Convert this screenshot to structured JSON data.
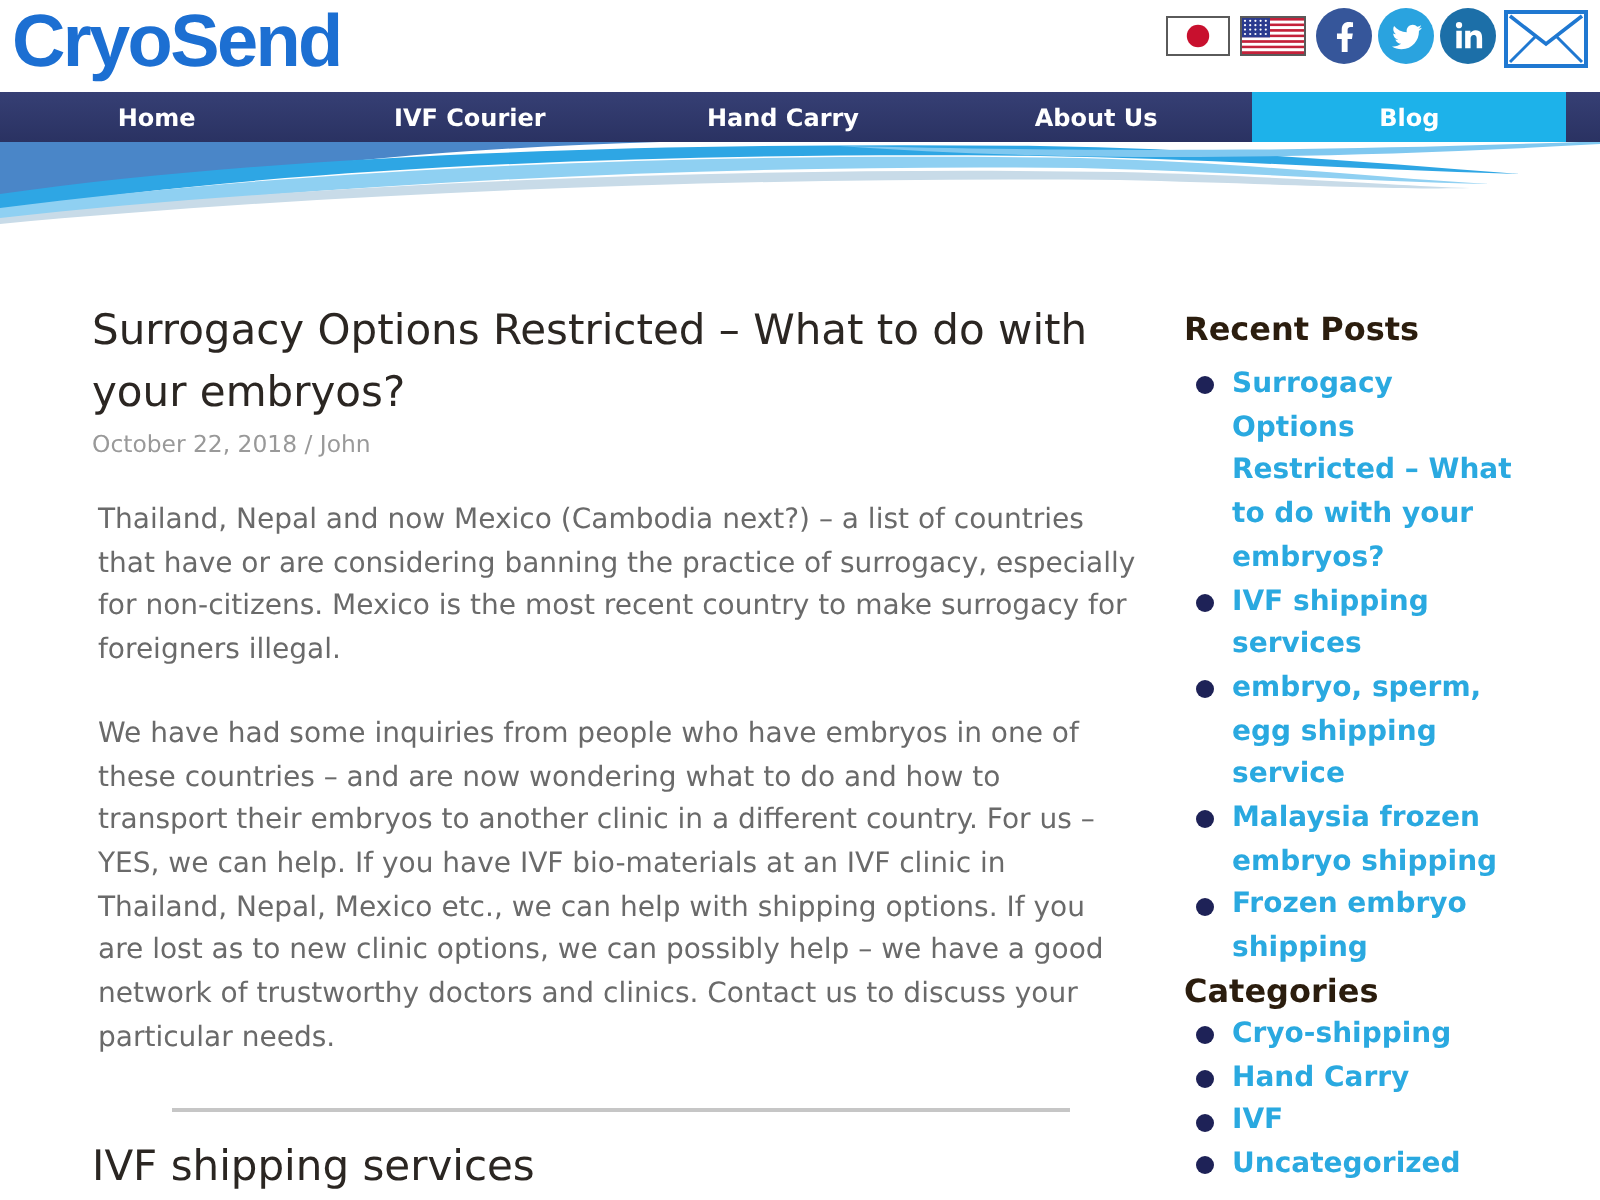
{
  "logo": {
    "text": "CryoSend"
  },
  "nav": [
    {
      "label": "Home",
      "selected": false
    },
    {
      "label": "IVF Courier",
      "selected": false
    },
    {
      "label": "Hand Carry",
      "selected": false
    },
    {
      "label": "About Us",
      "selected": false
    },
    {
      "label": "Blog",
      "selected": true
    }
  ],
  "article": {
    "title": "Surrogacy Options Restricted – What to do with your embryos?",
    "meta": "October 22, 2018 / John",
    "paragraphs": [
      {
        "lines": [
          "Thailand, Nepal and now Mexico (Cambodia next?) – a list of countries",
          "that have or are considering banning the practice of surrogacy, especially",
          "for non-citizens. Mexico is the most recent country to make surrogacy for",
          "foreigners illegal."
        ]
      },
      {
        "lines": [
          "We have had some inquiries from people who have embryos in one of",
          "these countries – and are now wondering what to do and how to",
          "transport their embryos to another clinic in a different country. For us –",
          "YES, we can help. If you have IVF bio-materials at an IVF clinic in",
          "Thailand, Nepal, Mexico etc., we can help with shipping options. If you",
          "are lost as to new clinic options, we can possibly help – we have a good",
          "network of trustworthy doctors and clinics. Contact us to discuss your",
          "particular needs."
        ]
      }
    ]
  },
  "next_article": {
    "title": "IVF shipping services"
  },
  "sidebar": {
    "widgets": [
      {
        "heading": "Recent Posts",
        "items": [
          "Surrogacy Options Restricted – What to do with your embryos?",
          "IVF shipping services",
          "embryo, sperm, egg shipping service",
          "Malaysia frozen embryo shipping",
          "Frozen embryo shipping"
        ]
      },
      {
        "heading": "Categories",
        "items": [
          "Cryo-shipping",
          "Hand Carry",
          "IVF",
          "Uncategorized"
        ]
      }
    ]
  }
}
